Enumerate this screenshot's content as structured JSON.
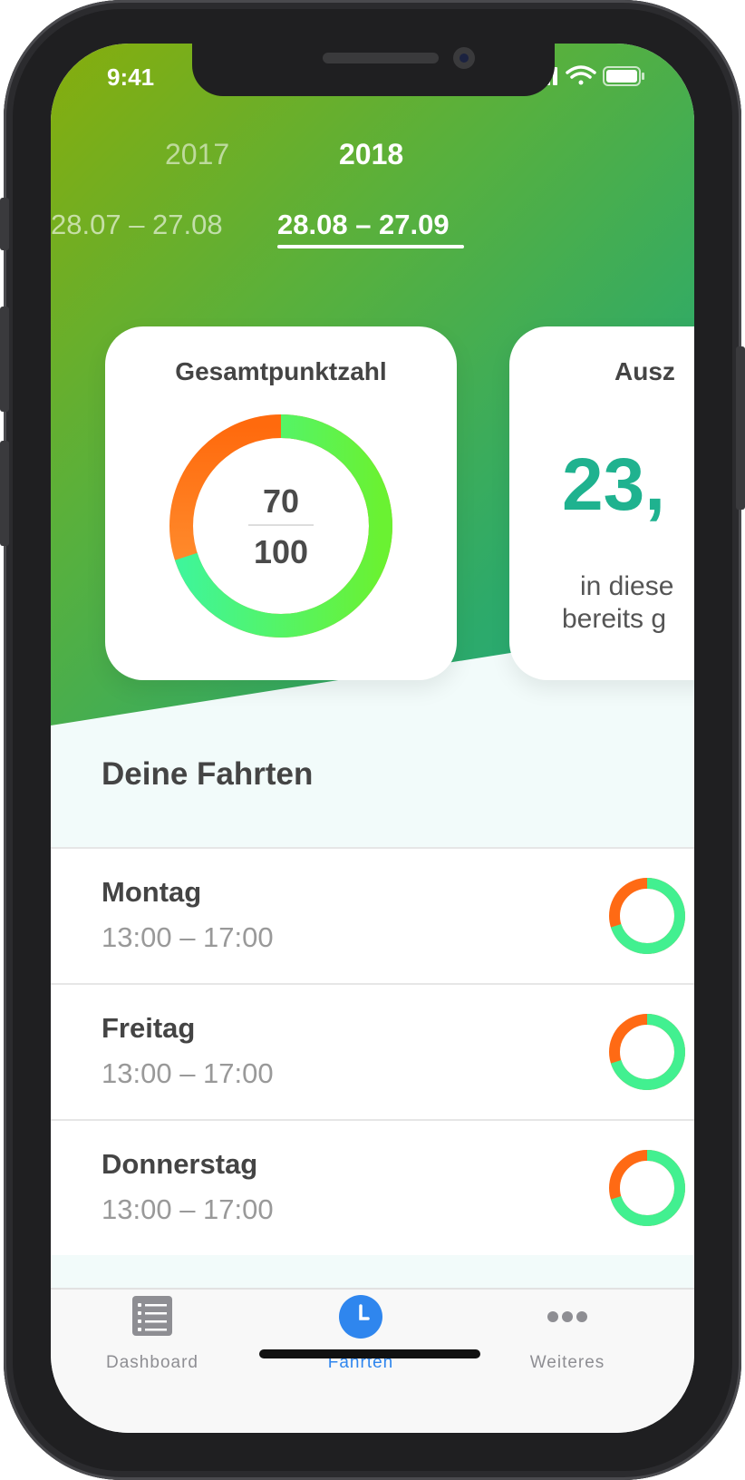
{
  "status_bar": {
    "time": "9:41"
  },
  "years": {
    "previous": "2017",
    "current": "2018"
  },
  "periods": {
    "previous": "28.07 – 27.08",
    "current": "28.08 – 27.09"
  },
  "score_card": {
    "title": "Gesamtpunktzahl",
    "score": "70",
    "max": "100",
    "score_fraction": 0.7,
    "colors": {
      "good": "#4cf07a",
      "bad": "#ff6a14"
    }
  },
  "payout_card": {
    "title": "Ausz",
    "amount": "23,",
    "desc_line1": "in diese",
    "desc_line2": "bereits g",
    "color": "#1fb28f"
  },
  "section": {
    "title": "Deine Fahrten"
  },
  "trips": [
    {
      "day": "Montag",
      "time": "13:00 – 17:00"
    },
    {
      "day": "Freitag",
      "time": "13:00 – 17:00"
    },
    {
      "day": "Donnerstag",
      "time": "13:00 – 17:00"
    }
  ],
  "tabbar": {
    "tabs": [
      {
        "label": "Dashboard",
        "icon": "list-icon",
        "active": false
      },
      {
        "label": "Fahrten",
        "icon": "clock-icon",
        "active": true
      },
      {
        "label": "Weiteres",
        "icon": "more-dots-icon",
        "active": false
      }
    ],
    "accent": "#2f86ee"
  }
}
